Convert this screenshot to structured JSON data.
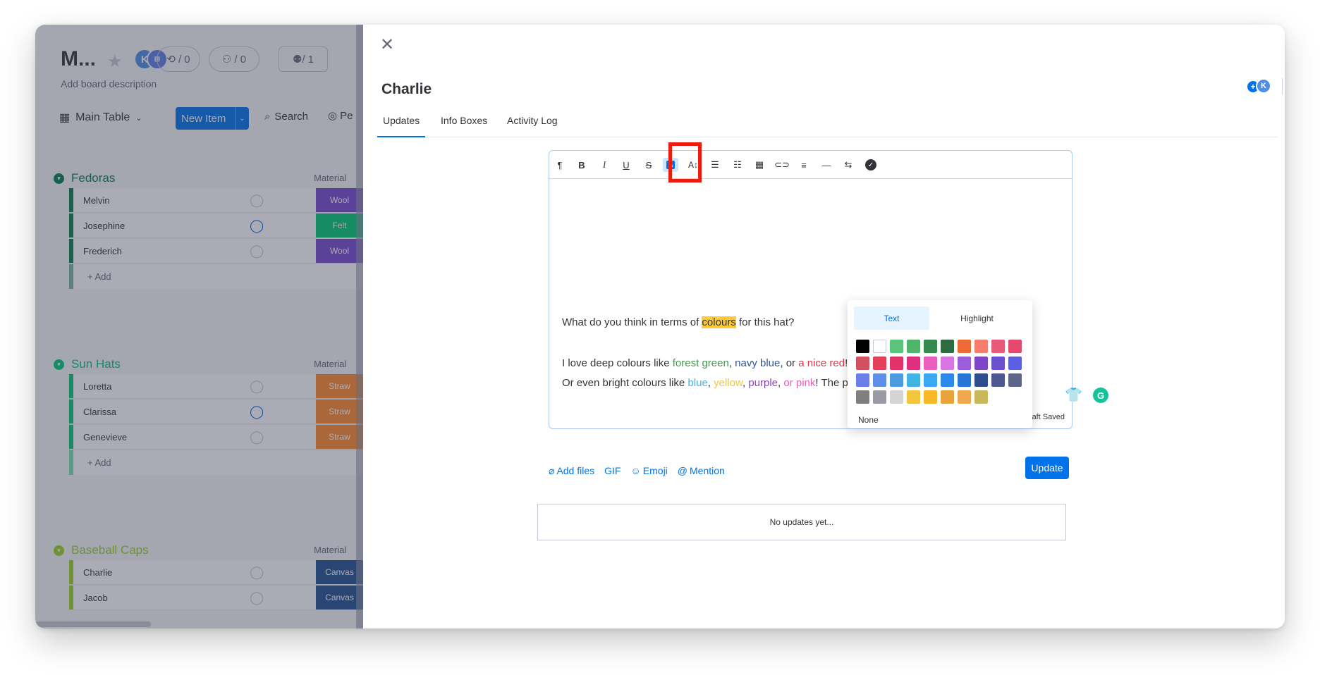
{
  "board": {
    "title": "M...",
    "description": "Add board description",
    "avatar_initial": "K",
    "automations_count": "/ 0",
    "integrations_count": "/ 0",
    "members_count": "1",
    "view_label": "Main Table",
    "new_item_label": "New Item",
    "search_label": "Search",
    "person_label": "Pe",
    "groups": [
      {
        "name": "Fedoras",
        "color": "#037f4c",
        "column_label": "Material",
        "rows": [
          {
            "name": "Melvin",
            "status": "Wool",
            "status_color": "#784bd1",
            "has_updates": false
          },
          {
            "name": "Josephine",
            "status": "Felt",
            "status_color": "#00c875",
            "has_updates": true,
            "updates_count": "1"
          },
          {
            "name": "Frederich",
            "status": "Wool",
            "status_color": "#784bd1",
            "has_updates": false
          }
        ],
        "add_label": "+ Add"
      },
      {
        "name": "Sun Hats",
        "color": "#00c875",
        "column_label": "Material",
        "rows": [
          {
            "name": "Loretta",
            "status": "Straw",
            "status_color": "#ff8a2b",
            "has_updates": false
          },
          {
            "name": "Clarissa",
            "status": "Straw",
            "status_color": "#ff8a2b",
            "has_updates": true,
            "updates_count": "1"
          },
          {
            "name": "Genevieve",
            "status": "Straw",
            "status_color": "#ff8a2b",
            "has_updates": false
          }
        ],
        "add_label": "+ Add"
      },
      {
        "name": "Baseball Caps",
        "color": "#9cd326",
        "column_label": "Material",
        "rows": [
          {
            "name": "Charlie",
            "status": "Canvas",
            "status_color": "#225091",
            "has_updates": false
          },
          {
            "name": "Jacob",
            "status": "Canvas",
            "status_color": "#225091",
            "has_updates": false
          }
        ]
      }
    ]
  },
  "panel": {
    "item_title": "Charlie",
    "avatar_initial": "K",
    "tabs": [
      "Updates",
      "Info Boxes",
      "Activity Log"
    ],
    "active_tab": "Updates"
  },
  "editor": {
    "toolbar": [
      "paragraph-icon",
      "bold-icon",
      "italic-icon",
      "underline-icon",
      "strikethrough-icon",
      "text-color-icon",
      "font-size-icon",
      "numbered-list-icon",
      "bullet-list-icon",
      "table-icon",
      "link-icon",
      "align-icon",
      "divider-icon",
      "direction-icon",
      "checklist-icon"
    ],
    "color_popup": {
      "tab_text": "Text",
      "tab_highlight": "Highlight",
      "active_tab": "Text",
      "swatches": [
        "#000000",
        "#ffffff",
        "#5ac47d",
        "#4fb56b",
        "#368a4f",
        "#2f6b41",
        "#f06a37",
        "#f77c6c",
        "#e85a7a",
        "#e44a6e",
        "#d2505f",
        "#e44058",
        "#e2326a",
        "#df2f7f",
        "#ea5fbd",
        "#d776e3",
        "#9b5dd9",
        "#7e45c9",
        "#6a4fd1",
        "#5c5fe0",
        "#6a7de8",
        "#5f8fe6",
        "#4d9be0",
        "#40b4e4",
        "#3aa8f2",
        "#2b89ea",
        "#2776d8",
        "#2f4e8f",
        "#4d5794",
        "#5d6588",
        "#7f7f7f",
        "#999aa3",
        "#d4d4d4",
        "#f3c53d",
        "#f7b928",
        "#e8a33a",
        "#f0a84e",
        "#c9b85a"
      ],
      "none_label": "None"
    },
    "line1": {
      "before": "What do you think in terms of ",
      "highlighted": "colours",
      "after": " for this hat?"
    },
    "line2": {
      "before": "I love deep colours like ",
      "forest": "forest green",
      "sep1": ", ",
      "navy": "navy blue",
      "sep2": ", or ",
      "red": "a nice red",
      "end": "!"
    },
    "line3": {
      "before": "Or even bright colours like ",
      "blue": "blue",
      "sep1": ", ",
      "yellow": "yellow",
      "sep2": ", ",
      "purple": "purple",
      "sep3": ", ",
      "pink": "or pink",
      "end": "! The possibilities are endless!"
    },
    "colors": {
      "highlight": "#fdcb3a",
      "forest": "#3a9a4a",
      "navy": "#2e55a0",
      "red": "#e2334a",
      "blue": "#3fb8e6",
      "yellow": "#f3c53d",
      "purple": "#8e44c9",
      "pink": "#ea5fbd"
    },
    "draft_status": "Draft Saved"
  },
  "actions": {
    "add_files": "Add files",
    "gif": "GIF",
    "emoji": "Emoji",
    "mention": "Mention",
    "update_button": "Update"
  },
  "feed": {
    "empty_text": "No updates yet..."
  }
}
